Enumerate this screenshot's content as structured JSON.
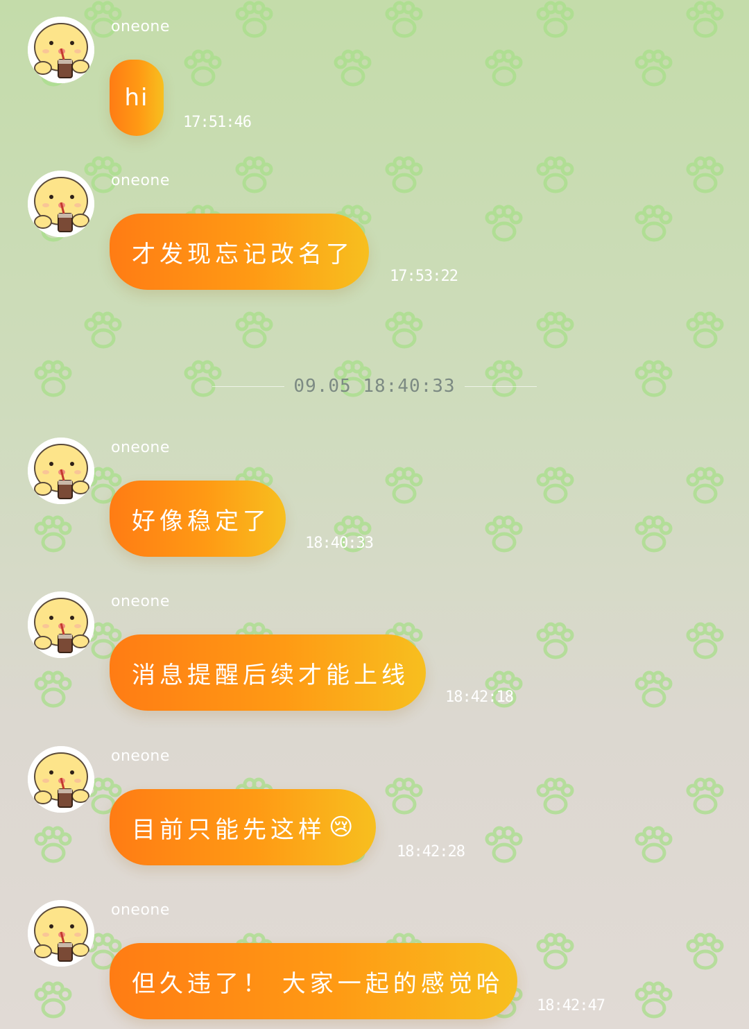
{
  "theme": {
    "bubble_start": "#ff7c14",
    "bubble_end": "#f7bf1f",
    "paw_color": "#a8df8a"
  },
  "divider": {
    "text": "09.05  18:40:33"
  },
  "messages": [
    {
      "sender": "oneone",
      "avatar_icon": "cartoon-chick-with-drink-avatar",
      "text": "hi",
      "time": "17:51:46"
    },
    {
      "sender": "oneone",
      "avatar_icon": "cartoon-chick-with-drink-avatar",
      "text": "才发现忘记改名了",
      "time": "17:53:22"
    },
    {
      "sender": "oneone",
      "avatar_icon": "cartoon-chick-with-drink-avatar",
      "text": "好像稳定了",
      "time": "18:40:33"
    },
    {
      "sender": "oneone",
      "avatar_icon": "cartoon-chick-with-drink-avatar",
      "text": "消息提醒后续才能上线",
      "time": "18:42:18"
    },
    {
      "sender": "oneone",
      "avatar_icon": "cartoon-chick-with-drink-avatar",
      "text": "目前只能先这样",
      "emoji": "😢",
      "time": "18:42:28"
    },
    {
      "sender": "oneone",
      "avatar_icon": "cartoon-chick-with-drink-avatar",
      "text": "但久违了！ 大家一起的感觉哈",
      "time": "18:42:47"
    }
  ]
}
